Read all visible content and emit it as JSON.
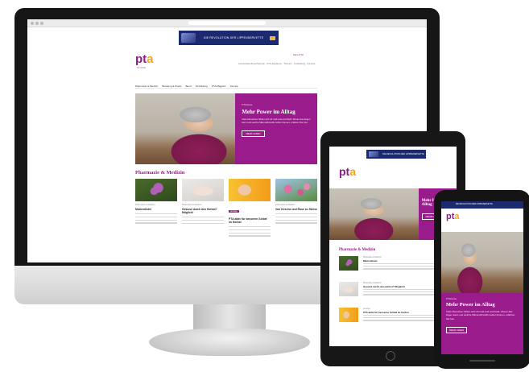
{
  "site": {
    "logo_main": "pt",
    "logo_accent": "a",
    "logo_sub": "IN LOVE"
  },
  "ad": {
    "text": "DIE REVOLUTION DER LIPPENSERVETTE"
  },
  "header": {
    "login": "Mein PTA",
    "meta_links": "Arzneimittel-Sprechstunde · PTA-Akademie · Themen · Fortbildung · Karriere"
  },
  "nav": {
    "items": [
      "Pharmazie & Medizin",
      "Beratung & Praxis",
      "Beruf",
      "Fortbildung",
      "PTA-Magazin",
      "Service"
    ]
  },
  "hero": {
    "kicker": "PTAheute",
    "title": "Mehr Power im Alltag",
    "body": "Viele Menschen fühlen sich oft matt und erschöpft. Woran das liegen kann und welche Mikronährstoffe helfen können, erfahren Sie hier.",
    "cta": "MEHR LESEN"
  },
  "section": {
    "title": "Pharmazie & Medizin"
  },
  "cards": [
    {
      "category": "Pharmazie & Medizin",
      "title": "Mariendistel",
      "tag": ""
    },
    {
      "category": "Pharmazie & Medizin",
      "title": "Gesund durch den Herbst? Möglich!",
      "tag": ""
    },
    {
      "category": "Pharmazie & Medizin",
      "title": "PTA aktiv für besseren Schlaf im Herbst",
      "tag": "Anzeige"
    },
    {
      "category": "Pharmazie & Medizin",
      "title": "Von Kirsche und Rose zu Stress",
      "tag": ""
    }
  ],
  "tablet": {
    "rows": [
      {
        "category": "Pharmazie & Medizin",
        "title": "Mariendistel"
      },
      {
        "category": "Pharmazie & Medizin",
        "title": "Gesund durch den Herbst? Möglich!"
      },
      {
        "category": "Anzeige",
        "title": "PTA aktiv für besseren Schlaf im Herbst"
      }
    ]
  },
  "phone": {
    "kicker": "PTAheute",
    "title": "Mehr Power im Alltag",
    "body": "Viele Menschen fühlen sich oft matt und erschöpft. Woran das liegen kann und welche Mikronährstoffe helfen können, erfahren Sie hier.",
    "cta": "MEHR LESEN"
  }
}
